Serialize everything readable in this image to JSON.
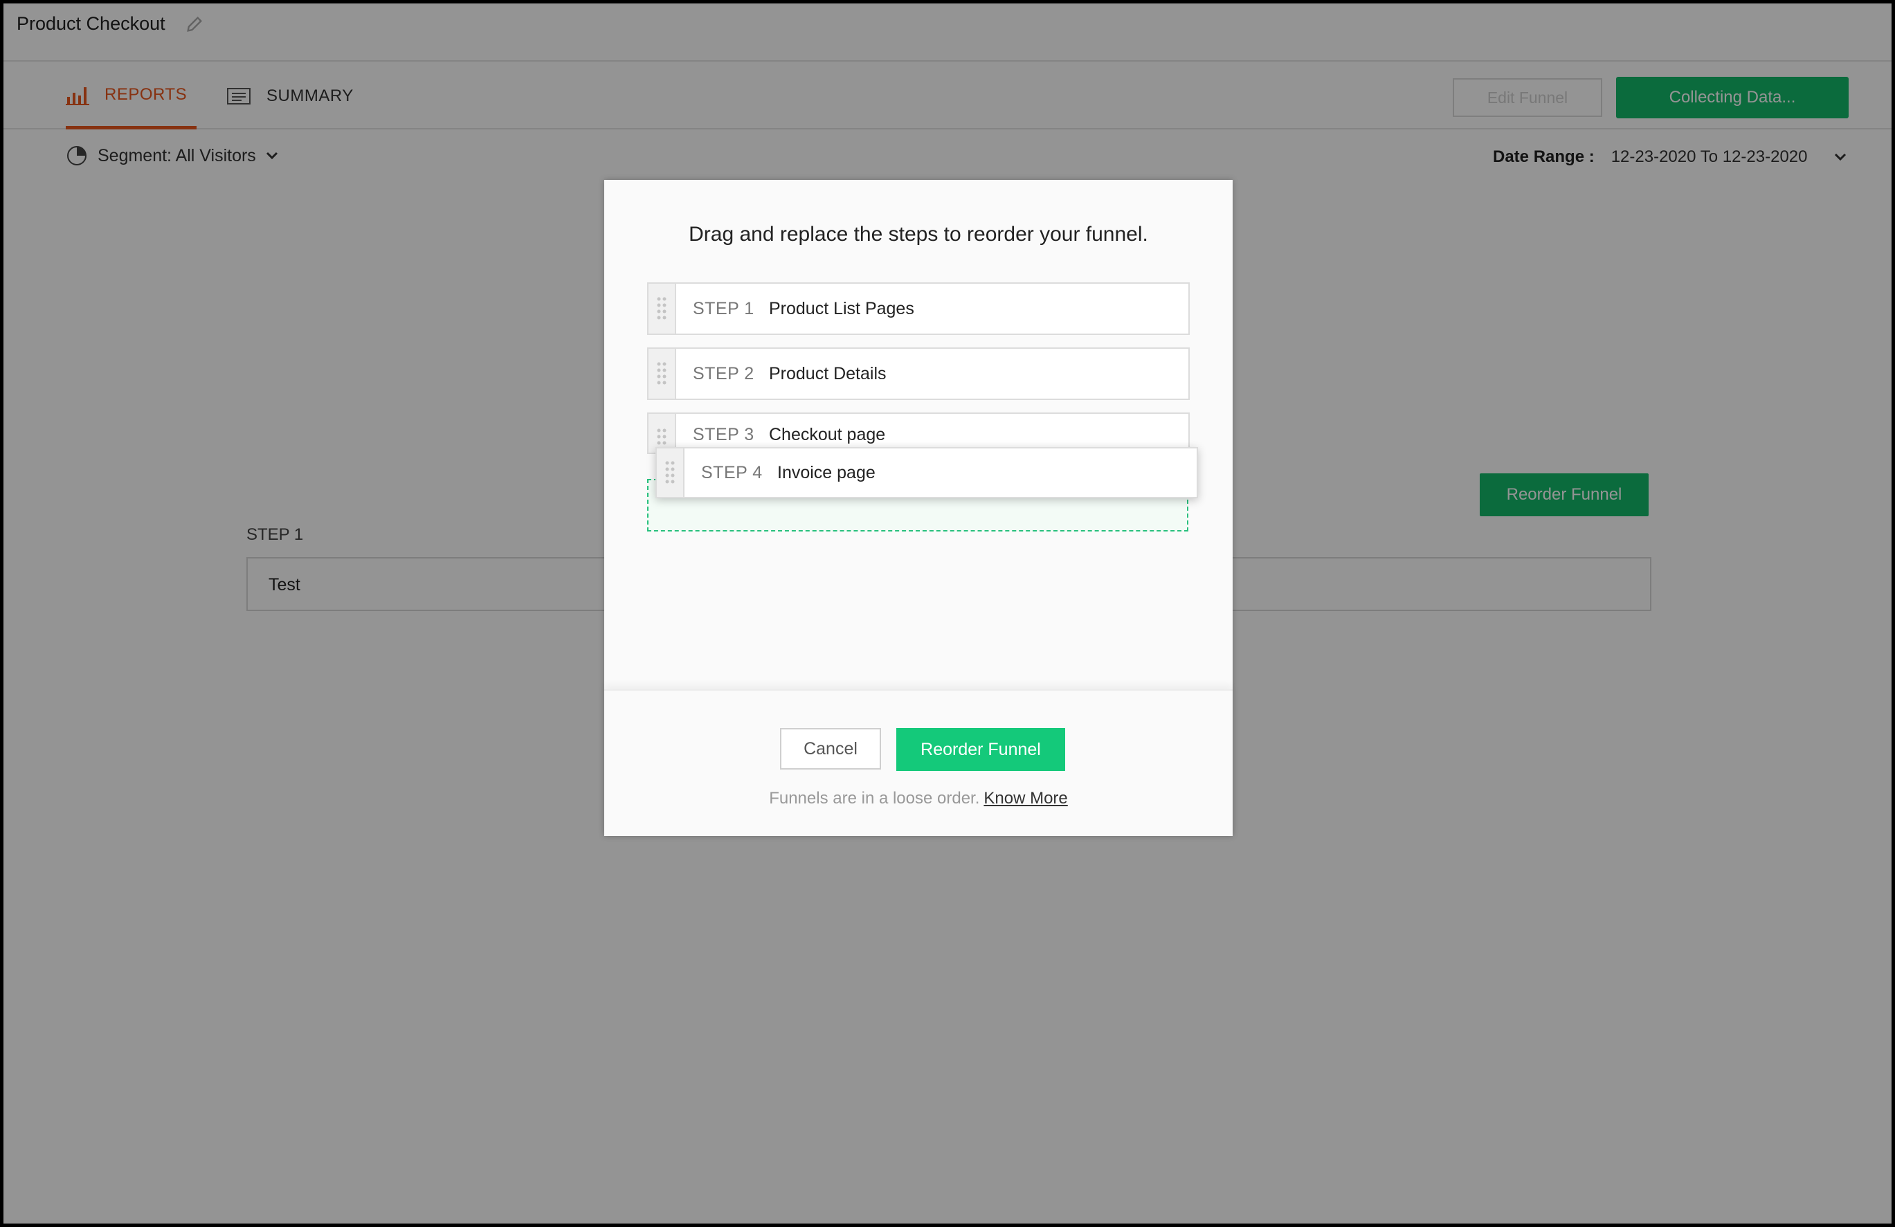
{
  "header": {
    "title": "Product Checkout"
  },
  "tabs": [
    {
      "label": "REPORTS",
      "active": true
    },
    {
      "label": "SUMMARY",
      "active": false
    }
  ],
  "actions": {
    "edit_label": "Edit Funnel",
    "collect_label": "Collecting Data..."
  },
  "filters": {
    "segment_label": "Segment: All Visitors",
    "date_range_label": "Date Range :",
    "date_range_value": "12-23-2020 To 12-23-2020"
  },
  "background": {
    "reorder_label": "Reorder Funnel",
    "step_label": "STEP 1",
    "step_value": "Test"
  },
  "modal": {
    "title": "Drag and replace the steps to reorder your funnel.",
    "steps": [
      {
        "num": "STEP 1",
        "name": "Product List Pages"
      },
      {
        "num": "STEP 2",
        "name": "Product Details"
      },
      {
        "num": "STEP 3",
        "name": "Checkout page"
      },
      {
        "num": "STEP 4",
        "name": "Invoice page"
      }
    ],
    "cancel_label": "Cancel",
    "reorder_label": "Reorder Funnel",
    "note": "Funnels are in a loose order.",
    "know_more": "Know More"
  },
  "colors": {
    "accent_green": "#14b86a",
    "reports_orange": "#e8561e"
  }
}
